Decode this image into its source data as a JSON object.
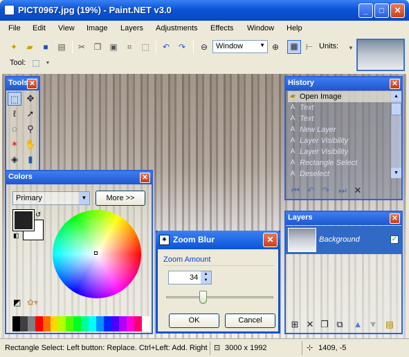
{
  "window": {
    "title": "PICT0967.jpg (19%) - Paint.NET v3.0",
    "min": "_",
    "max": "□",
    "close": "✕"
  },
  "menu": [
    "File",
    "Edit",
    "View",
    "Image",
    "Layers",
    "Adjustments",
    "Effects",
    "Window",
    "Help"
  ],
  "toolbar": {
    "zoom_value": "Window",
    "units_label": "Units:"
  },
  "toolbar2": {
    "tool_label": "Tool:"
  },
  "tools_panel": {
    "title": "Tools"
  },
  "colors_panel": {
    "title": "Colors",
    "palette_select": "Primary",
    "more_button": "More >>"
  },
  "history_panel": {
    "title": "History",
    "items": [
      {
        "label": "Open Image",
        "current": true
      },
      {
        "label": "Text"
      },
      {
        "label": "Text"
      },
      {
        "label": "New Layer"
      },
      {
        "label": "Layer Visibility"
      },
      {
        "label": "Layer Visibility"
      },
      {
        "label": "Rectangle Select"
      },
      {
        "label": "Deselect"
      }
    ]
  },
  "layers_panel": {
    "title": "Layers",
    "layer_name": "Background",
    "visible": true
  },
  "zoom_dialog": {
    "title": "Zoom Blur",
    "group_label": "Zoom Amount",
    "amount": "34",
    "ok": "OK",
    "cancel": "Cancel",
    "slider_fraction": 0.34
  },
  "status": {
    "text": "Rectangle Select: Left button: Replace. Ctrl+Left: Add. Right",
    "image_size": "3000 x 1992",
    "cursor": "1409, -5"
  },
  "palette_colors": [
    "#000000",
    "#404040",
    "#808080",
    "#ff0000",
    "#ff6a00",
    "#ffd800",
    "#b6ff00",
    "#4cff00",
    "#00ff21",
    "#00ff90",
    "#00ffff",
    "#0094ff",
    "#0026ff",
    "#4800ff",
    "#b200ff",
    "#ff00dc",
    "#ff006e",
    "#ffffff"
  ]
}
